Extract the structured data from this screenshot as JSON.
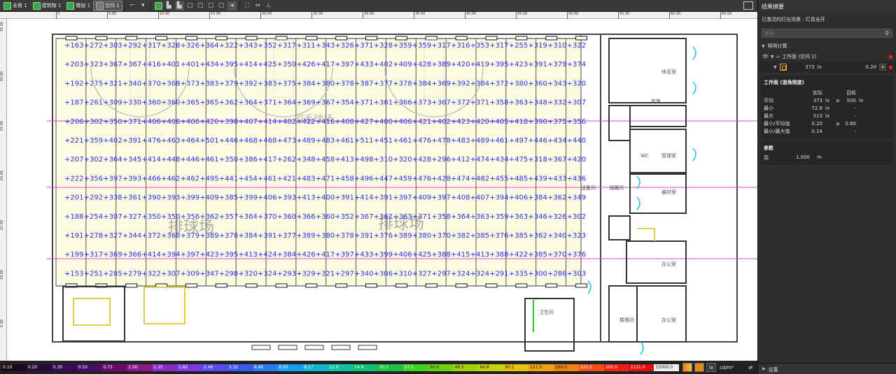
{
  "toolbar": {
    "items": [
      {
        "label": "全景 1",
        "icon": "scene-icon"
      },
      {
        "label": "建筑物 1",
        "icon": "building-icon"
      },
      {
        "label": "楼层 1",
        "icon": "floor-icon"
      },
      {
        "label": "空间 1",
        "icon": "room-icon"
      }
    ]
  },
  "rulers": {
    "top": [
      "0",
      "5.00",
      "10.00",
      "15.00",
      "20.00",
      "25.00",
      "30.00",
      "35.00",
      "40.00",
      "45.00",
      "50.00",
      "55.00",
      "60.00",
      "65.00",
      "70.00"
    ],
    "left": [
      "35.00",
      "30.00",
      "25.00",
      "20.00",
      "15.00",
      "10.00",
      "5.00",
      "0"
    ]
  },
  "floorplan": {
    "court_labels": [
      "排球场",
      "排球场"
    ],
    "top_label": "羽毛球场",
    "rooms": [
      "休息室",
      "WC",
      "管理室",
      "器材室",
      "设备间",
      "储藏间",
      "办公室",
      "楼梯间",
      "办公室",
      "库房",
      "卫生间"
    ],
    "grid_values": [
      [
        163,
        272,
        303,
        292,
        317,
        328,
        326,
        364,
        322,
        343,
        352,
        317,
        311,
        343,
        326,
        371,
        328,
        359,
        359,
        317,
        316,
        353,
        317,
        255,
        319,
        310,
        322
      ],
      [
        203,
        323,
        367,
        367,
        416,
        401,
        401,
        434,
        395,
        414,
        425,
        350,
        426,
        417,
        397,
        433,
        402,
        409,
        428,
        389,
        420,
        419,
        395,
        423,
        391,
        379,
        374
      ],
      [
        192,
        275,
        321,
        340,
        370,
        368,
        373,
        383,
        379,
        392,
        383,
        375,
        384,
        380,
        378,
        387,
        377,
        378,
        384,
        369,
        392,
        384,
        372,
        380,
        360,
        343,
        320
      ],
      [
        187,
        261,
        309,
        330,
        360,
        360,
        365,
        365,
        362,
        364,
        371,
        364,
        369,
        367,
        354,
        371,
        361,
        366,
        373,
        367,
        372,
        371,
        358,
        363,
        348,
        332,
        307
      ],
      [
        206,
        302,
        350,
        371,
        406,
        406,
        406,
        420,
        398,
        407,
        414,
        402,
        422,
        416,
        408,
        427,
        400,
        406,
        421,
        402,
        423,
        420,
        405,
        418,
        390,
        375,
        356
      ],
      [
        221,
        359,
        402,
        391,
        476,
        463,
        464,
        501,
        446,
        468,
        468,
        473,
        489,
        483,
        461,
        511,
        451,
        461,
        476,
        478,
        483,
        489,
        461,
        497,
        446,
        434,
        440
      ],
      [
        207,
        302,
        364,
        345,
        414,
        448,
        446,
        461,
        350,
        386,
        417,
        262,
        348,
        458,
        413,
        498,
        310,
        320,
        428,
        296,
        412,
        474,
        434,
        475,
        318,
        367,
        420
      ],
      [
        222,
        356,
        397,
        393,
        466,
        462,
        462,
        495,
        441,
        454,
        461,
        421,
        483,
        471,
        458,
        496,
        447,
        459,
        476,
        428,
        474,
        482,
        455,
        485,
        439,
        433,
        436
      ],
      [
        201,
        292,
        338,
        361,
        390,
        393,
        399,
        409,
        385,
        399,
        406,
        393,
        413,
        400,
        391,
        414,
        391,
        397,
        409,
        397,
        408,
        407,
        394,
        406,
        384,
        362,
        349
      ],
      [
        188,
        254,
        307,
        327,
        350,
        350,
        356,
        362,
        357,
        364,
        370,
        360,
        366,
        360,
        352,
        367,
        362,
        363,
        371,
        358,
        364,
        363,
        359,
        363,
        346,
        326,
        302
      ],
      [
        191,
        278,
        327,
        344,
        372,
        368,
        379,
        389,
        378,
        384,
        391,
        377,
        389,
        380,
        378,
        391,
        376,
        389,
        380,
        370,
        382,
        385,
        376,
        385,
        362,
        340,
        323
      ],
      [
        199,
        317,
        369,
        366,
        414,
        394,
        397,
        423,
        395,
        413,
        424,
        384,
        426,
        417,
        397,
        433,
        399,
        406,
        425,
        388,
        415,
        413,
        388,
        422,
        385,
        370,
        376
      ],
      [
        153,
        251,
        285,
        279,
        322,
        307,
        309,
        347,
        298,
        320,
        324,
        293,
        329,
        321,
        297,
        340,
        306,
        310,
        327,
        297,
        324,
        324,
        291,
        335,
        300,
        286,
        303
      ]
    ]
  },
  "legend": {
    "values": [
      "0.10",
      "0.20",
      "0.30",
      "0.50",
      "0.75",
      "1.00",
      "1.35",
      "1.82",
      "2.46",
      "3.32",
      "4.48",
      "6.05",
      "8.17",
      "11.0",
      "14.9",
      "20.1",
      "27.1",
      "36.6",
      "49.5",
      "66.8",
      "90.2",
      "121.0",
      "164.0",
      "222.0",
      "300.0",
      "2121.0",
      "15000.0"
    ],
    "colors": [
      "#1a0a1a",
      "#2a0a3a",
      "#3a0a5a",
      "#4a0a6a",
      "#6a0a6a",
      "#8a1a8a",
      "#8a2ac0",
      "#7a3ae0",
      "#5a4af0",
      "#3a5af0",
      "#2a7af0",
      "#1a9af0",
      "#10b0d0",
      "#10c0a0",
      "#10c070",
      "#20c040",
      "#40d020",
      "#70d010",
      "#a0d010",
      "#c8d010",
      "#e8c010",
      "#f0a010",
      "#f08010",
      "#f05010",
      "#f02010",
      "#e01010",
      "#f0f0f0"
    ],
    "unit_lx": "lx",
    "unit_cd": "cd/m²"
  },
  "panel": {
    "title": "结果摘要",
    "scene": "已激活的灯光场景 : 灯具全开",
    "search_placeholder": "搜索",
    "calc_section": "照明计算",
    "workplane": "工作面 (空间 1)",
    "wp_value": "373",
    "wp_unit": "lx",
    "wp_ratio": "0.20",
    "table": {
      "title": "工作面 (道角照度)",
      "col_actual": "实际",
      "col_target": "目标",
      "rows": [
        {
          "label": "平均",
          "value": "373",
          "unit": "lx",
          "cmp": "≥",
          "target": "500",
          "tunit": "lx"
        },
        {
          "label": "最小",
          "value": "72.8",
          "unit": "lx",
          "cmp": "",
          "target": "-",
          "tunit": ""
        },
        {
          "label": "最大",
          "value": "513",
          "unit": "lx",
          "cmp": "",
          "target": "-",
          "tunit": ""
        },
        {
          "label": "最小/平均值",
          "value": "0.20",
          "unit": "",
          "cmp": "≥",
          "target": "0.60",
          "tunit": ""
        },
        {
          "label": "最小/最大值",
          "value": "0.14",
          "unit": "",
          "cmp": "",
          "target": "-",
          "tunit": ""
        }
      ]
    },
    "params": {
      "title": "参数",
      "label": "高",
      "value": "1.000",
      "unit": "m"
    },
    "settings": "设置"
  },
  "colors": {
    "grid_text": "#2a2aff",
    "court_fill": "#fcfce0",
    "magenta": "#e040e0",
    "panel_bg": "#2e2e2e"
  }
}
